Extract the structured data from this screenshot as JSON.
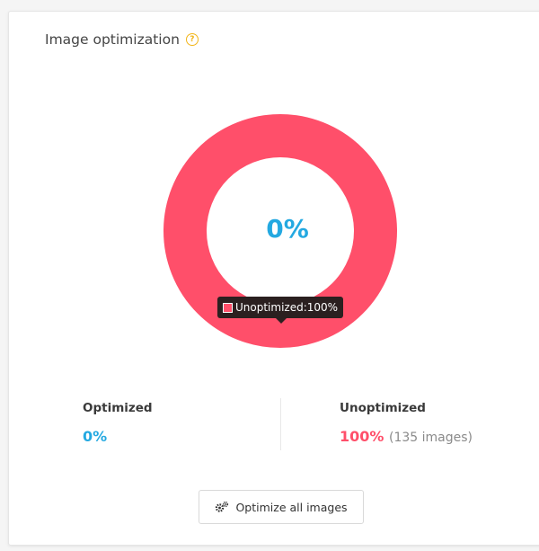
{
  "card": {
    "title": "Image optimization",
    "help_icon": "question-circle-icon"
  },
  "chart_data": {
    "type": "pie",
    "variant": "donut",
    "categories": [
      "Optimized",
      "Unoptimized"
    ],
    "values": [
      0,
      100
    ],
    "colors": [
      "#24a9e1",
      "#ff4f6a"
    ],
    "center_label": "0%",
    "tooltip": {
      "label": "Unoptimized:100%",
      "color": "#ff4f6a"
    }
  },
  "stats": {
    "optimized": {
      "label": "Optimized",
      "value": "0%"
    },
    "unoptimized": {
      "label": "Unoptimized",
      "value": "100%",
      "note": "(135 images)"
    }
  },
  "button": {
    "label": "Optimize all images",
    "icon": "gears-icon"
  },
  "colors": {
    "accent_blue": "#24a9e1",
    "accent_red": "#ff4f6a",
    "help": "#f2b519"
  }
}
